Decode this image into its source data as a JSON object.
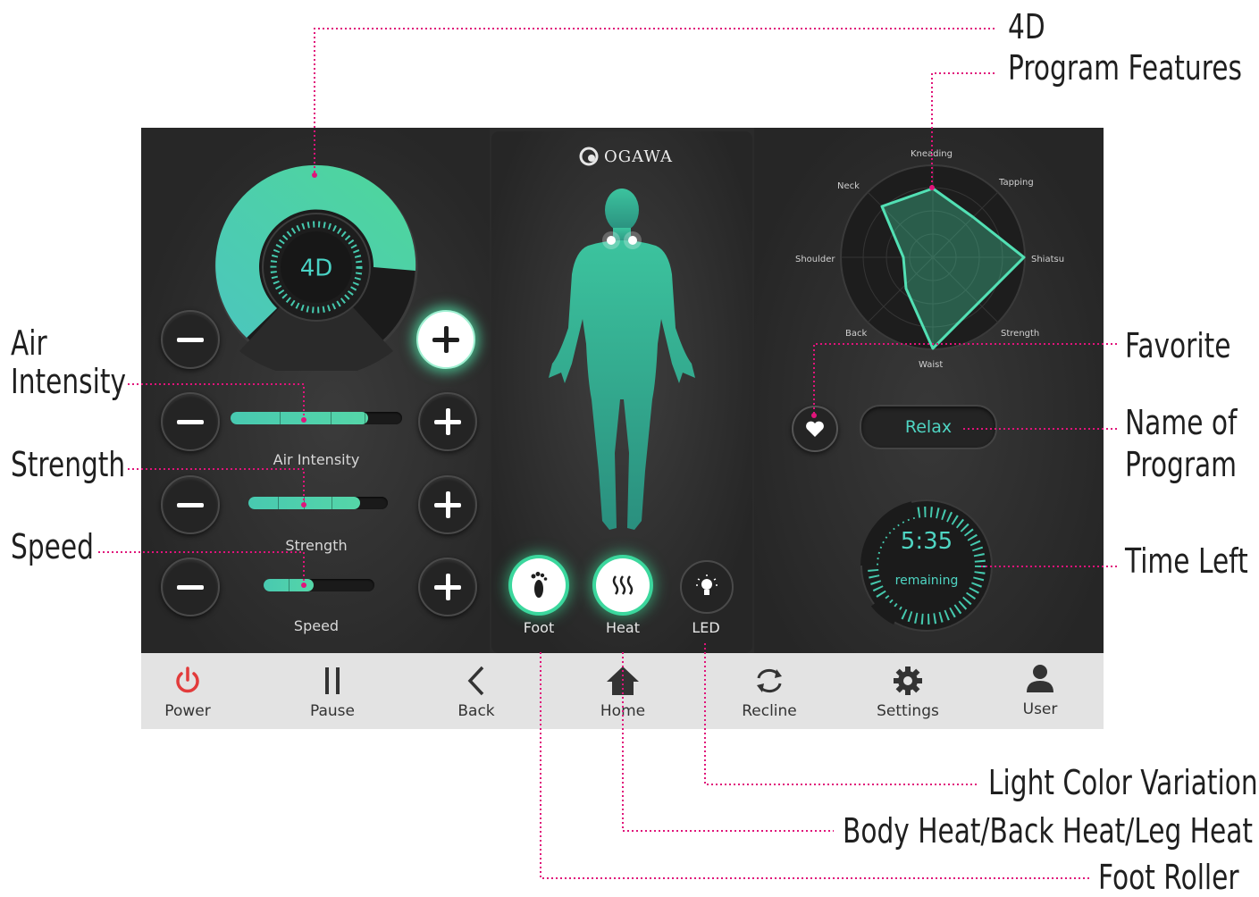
{
  "callouts": {
    "four_d": "4D",
    "program_features": "Program Features",
    "air": "Air",
    "intensity": "Intensity",
    "strength": "Strength",
    "speed": "Speed",
    "favorite": "Favorite",
    "name_of": "Name of",
    "program": "Program",
    "time_left": "Time Left",
    "light_color_variation": "Light Color Variation",
    "heat_types": "Body Heat/Back Heat/Leg Heat",
    "foot_roller": "Foot Roller"
  },
  "colors": {
    "accent": "#45d6a4",
    "callout_line": "#e0147a",
    "power_red": "#e23b3b"
  },
  "left": {
    "dial_label": "4D",
    "dial_level": 0.85,
    "sliders": [
      {
        "label": "Air Intensity",
        "level": 0.8
      },
      {
        "label": "Strength",
        "level": 0.8
      },
      {
        "label": "Speed",
        "level": 0.45
      }
    ]
  },
  "center": {
    "brand": "OGAWA",
    "modes": [
      {
        "label": "Foot",
        "icon": "foot-icon",
        "on": true
      },
      {
        "label": "Heat",
        "icon": "heat-icon",
        "on": true
      },
      {
        "label": "LED",
        "icon": "lightbulb-icon",
        "on": false
      }
    ]
  },
  "right": {
    "radar_axes": [
      "Kneading",
      "Tapping",
      "Shiatsu",
      "Strength",
      "Waist",
      "Back",
      "Shoulder",
      "Neck"
    ],
    "program_name": "Relax",
    "time": "5:35",
    "time_caption": "remaining"
  },
  "nav": [
    {
      "label": "Power",
      "icon": "power-icon"
    },
    {
      "label": "Pause",
      "icon": "pause-icon"
    },
    {
      "label": "Back",
      "icon": "back-arrow-icon"
    },
    {
      "label": "Home",
      "icon": "home-icon"
    },
    {
      "label": "Recline",
      "icon": "recline-icon"
    },
    {
      "label": "Settings",
      "icon": "gear-icon"
    },
    {
      "label": "User",
      "icon": "user-icon"
    }
  ]
}
